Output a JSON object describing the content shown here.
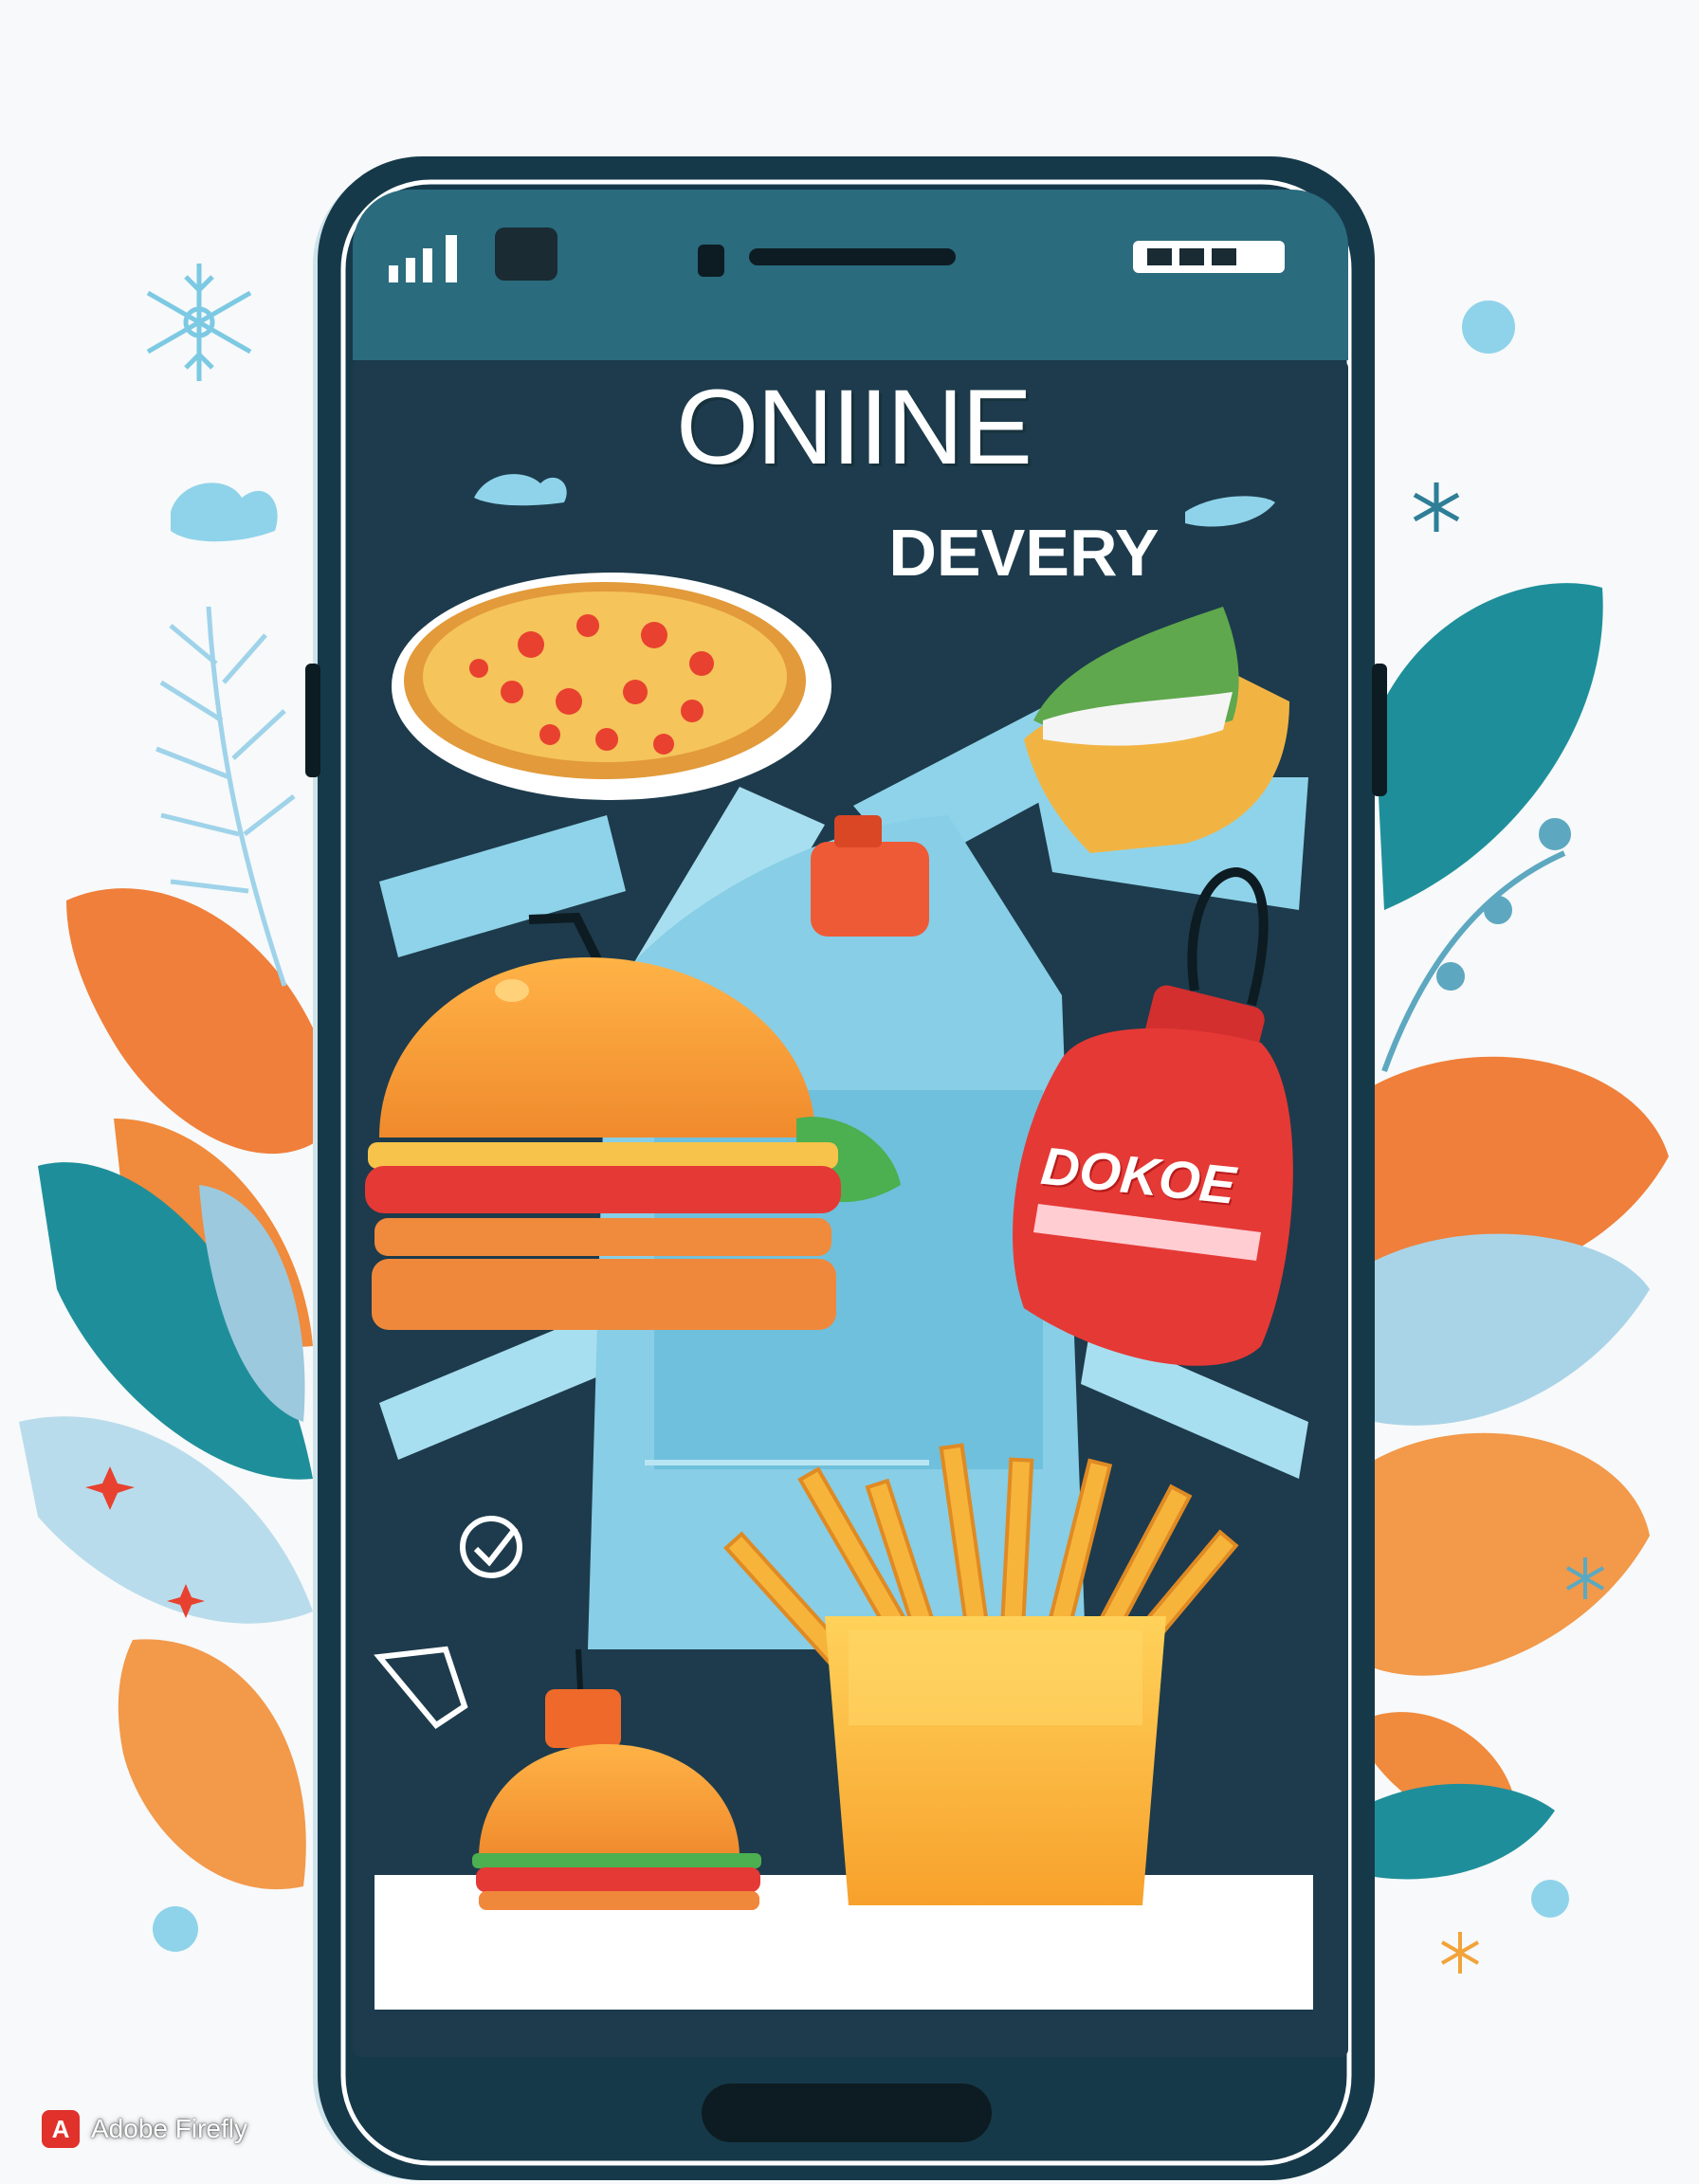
{
  "illustration": {
    "headline": "ONIINE",
    "subheadline": "DEVERY",
    "bottle_label": "DOKOE"
  },
  "watermark": {
    "logo_letter": "A",
    "text": "Adobe Firefly"
  },
  "colors": {
    "phone_body": "#16394a",
    "screen": "#1d3b4c",
    "accent_blue": "#8fd3ea",
    "leaf_orange": "#ef7f3a",
    "leaf_teal": "#1e8f9a",
    "ketchup_red": "#e53935",
    "fries_yellow": "#f6b43b"
  },
  "icons": [
    "snowflake-icon",
    "check-icon",
    "signal-icon",
    "battery-icon"
  ]
}
